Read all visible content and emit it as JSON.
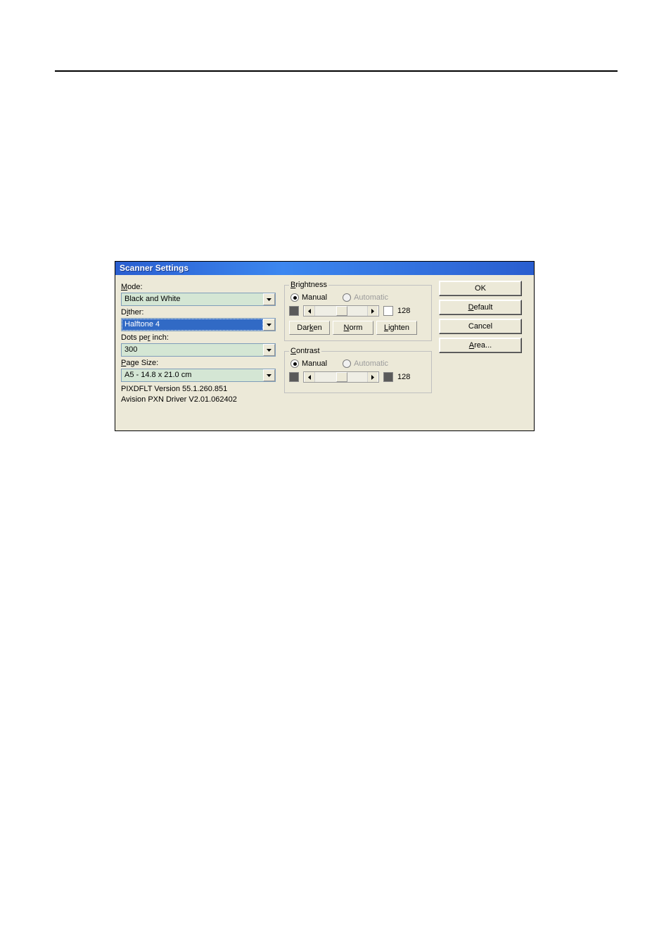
{
  "title": "Scanner Settings",
  "left": {
    "mode_label": "Mode:",
    "mode_value": "Black and White",
    "dither_label": "Dither:",
    "dither_value": "Halftone 4",
    "dpi_label": "Dots per inch:",
    "dpi_value": "300",
    "page_label": "Page Size:",
    "page_value": "A5 - 14.8 x 21.0 cm",
    "version1": "PIXDFLT Version 55.1.260.851",
    "version2": "Avision PXN Driver V2.01.062402"
  },
  "brightness": {
    "legend": "Brightness",
    "manual": "Manual",
    "automatic": "Automatic",
    "value": "128",
    "darken": "Darken",
    "norm": "Norm",
    "lighten": "Lighten"
  },
  "contrast": {
    "legend": "Contrast",
    "manual": "Manual",
    "automatic": "Automatic",
    "value": "128"
  },
  "buttons": {
    "ok": "OK",
    "default": "Default",
    "cancel": "Cancel",
    "area": "Area..."
  }
}
